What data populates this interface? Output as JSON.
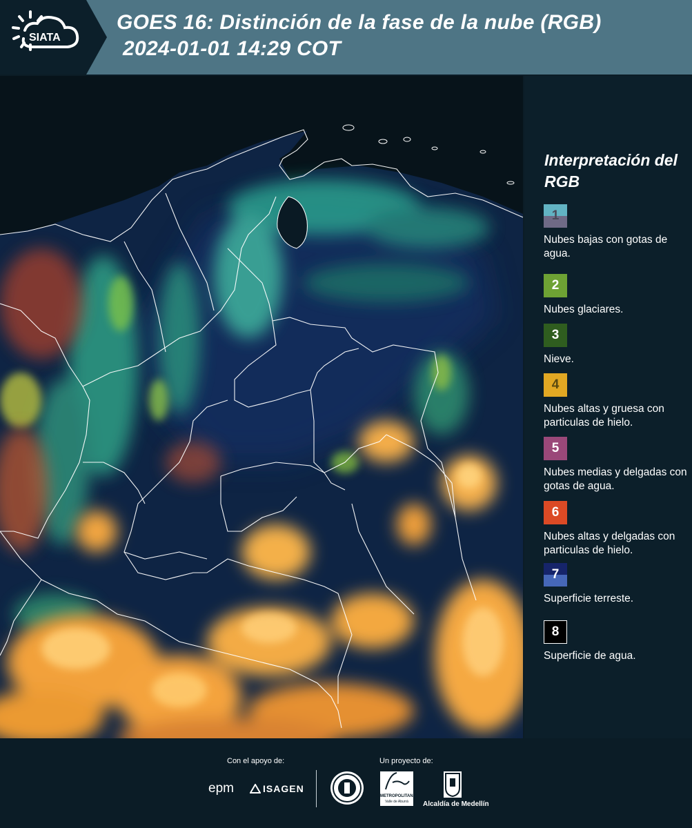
{
  "header": {
    "logo_text": "SIATA",
    "title_line1": "GOES 16: Distinción de la fase de la nube (RGB)",
    "title_line2": "2024-01-01 14:29 COT"
  },
  "legend": {
    "title": "Interpretación del RGB",
    "items": [
      {
        "num": "1",
        "label": "Nubes bajas con gotas de agua.",
        "color_top": "#62b3c3",
        "color_bottom": "#6f6a86"
      },
      {
        "num": "2",
        "label": "Nubes glaciares.",
        "color_top": "#6ea234",
        "color_bottom": "#6ea234"
      },
      {
        "num": "3",
        "label": "Nieve.",
        "color_top": "#2f5d1f",
        "color_bottom": "#2f5d1f"
      },
      {
        "num": "4",
        "label": "Nubes altas y gruesa con particulas de hielo.",
        "color_top": "#e2a823",
        "color_bottom": "#e2a823"
      },
      {
        "num": "5",
        "label": "Nubes medias y delgadas con gotas de agua.",
        "color_top": "#9a4879",
        "color_bottom": "#9a4879"
      },
      {
        "num": "6",
        "label": "Nubes altas y delgadas con particulas de hielo.",
        "color_top": "#dc4a25",
        "color_bottom": "#dc4a25"
      },
      {
        "num": "7",
        "label": "Superficie terreste.",
        "color_top": "#16246a",
        "color_bottom": "#4667b8"
      },
      {
        "num": "8",
        "label": "Superficie de agua.",
        "color_top": "#000000",
        "color_bottom": "#000000"
      }
    ]
  },
  "footer": {
    "support_label": "Con el apoyo de:",
    "project_label": "Un proyecto de:",
    "sponsor_epm": "epm",
    "sponsor_isagen": "ISAGEN",
    "org_area_line1": "METROPOLITANA",
    "org_area_line2": "Valle de Aburrá",
    "org_alcaldia": "Alcaldía de Medellín"
  }
}
